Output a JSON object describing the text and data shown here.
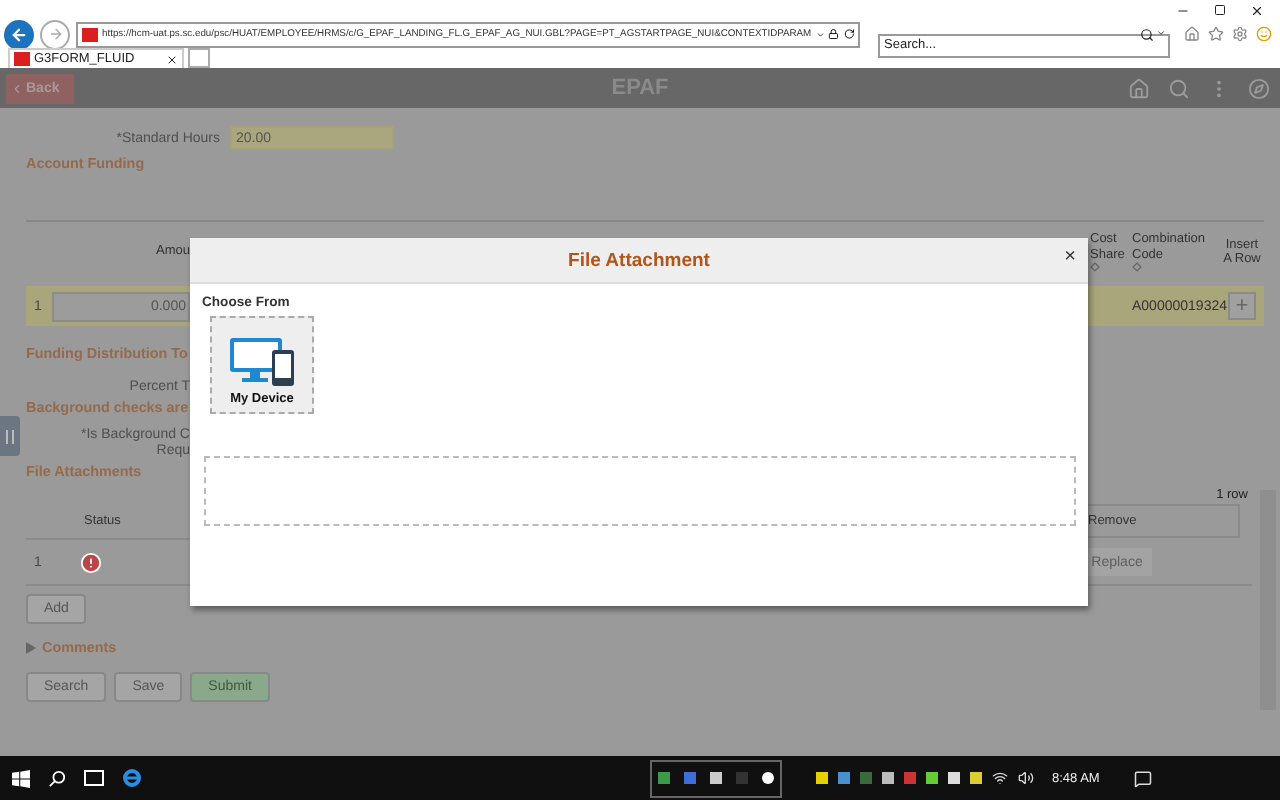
{
  "browser": {
    "url": "https://hcm-uat.ps.sc.edu/psc/HUAT/EMPLOYEE/HRMS/c/G_EPAF_LANDING_FL.G_EPAF_AG_NUI.GBL?PAGE=PT_AGSTARTPAGE_NUI&CONTEXTIDPARAM",
    "search": {
      "placeholder": "Search..."
    },
    "tabs": [
      {
        "label": "G3FORM_FLUID",
        "selected": true
      }
    ]
  },
  "header": {
    "back": "Back",
    "title": "EPAF"
  },
  "standard_hours": {
    "label": "*Standard Hours",
    "value": "20.00"
  },
  "account_funding": {
    "title": "Account Funding",
    "columns": [
      {
        "label": "Amou",
        "sortable": false
      },
      {
        "label": "Cost Share",
        "sortable": true
      },
      {
        "label": "Combination Code",
        "sortable": true
      },
      {
        "label": "Insert A Row",
        "sortable": false
      }
    ],
    "rows": [
      {
        "number": "1",
        "amount": "0.000",
        "combination_code": "A00000019324",
        "insert": "+"
      }
    ]
  },
  "funding_total": {
    "title": "Funding Distribution To",
    "label": "Percent T"
  },
  "background": {
    "title": "Background checks are",
    "label_lines": [
      "*Is Background C",
      "Requ"
    ]
  },
  "file_attachments": {
    "title": "File Attachments",
    "count": "1 row",
    "columns": [
      "Status",
      "Remove"
    ],
    "rows": [
      {
        "number": "1",
        "error": true,
        "replace": {
          "label": "Replace",
          "disabled": true
        }
      }
    ],
    "add": "Add"
  },
  "comments": {
    "label": "Comments",
    "expanded": false
  },
  "buttons": [
    {
      "label": "Search",
      "kind": "plain"
    },
    {
      "label": "Save",
      "kind": "plain"
    },
    {
      "label": "Submit",
      "kind": "primary"
    }
  ],
  "modal": {
    "title": "File Attachment",
    "close": "×",
    "section": "Choose From",
    "sources": [
      {
        "label": "My Device"
      }
    ]
  },
  "taskbar": {
    "time": "8:48 AM"
  }
}
